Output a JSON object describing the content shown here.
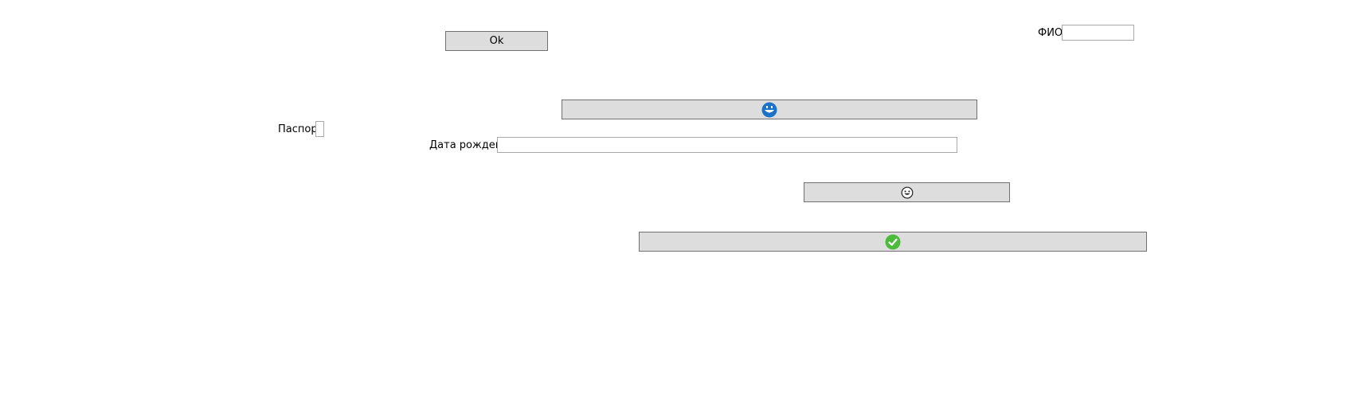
{
  "ok_button": {
    "label": "Ok"
  },
  "fio": {
    "label": "ФИО",
    "value": ""
  },
  "passport": {
    "label": "Паспорт",
    "value": ""
  },
  "birth_date": {
    "label": "Дата рождения",
    "value": ""
  },
  "buttons": {
    "top_wide": {
      "icon": "blue-face-icon",
      "color": "#1a73c9"
    },
    "middle": {
      "icon": "grinning-face-icon",
      "color": "#222222"
    },
    "bottom_wide": {
      "icon": "check-circle-icon",
      "color": "#4cbb3c"
    }
  }
}
